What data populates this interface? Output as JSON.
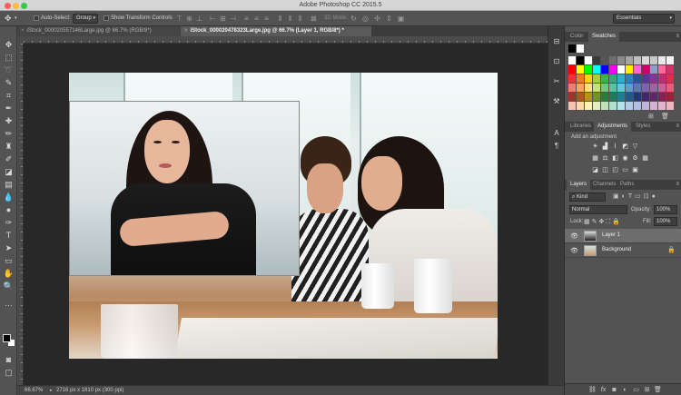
{
  "app": {
    "title": "Adobe Photoshop CC 2015.5"
  },
  "options_bar": {
    "auto_select_label": "Auto-Select:",
    "auto_select_value": "Group",
    "transform_controls_label": "Show Transform Controls",
    "mode_3d_label": "3D Mode:",
    "workspace": "Essentials"
  },
  "tabs": [
    {
      "label": "iStock_000020557146Large.jpg @ 66.7% (RGB/8*)",
      "active": false
    },
    {
      "label": "iStock_000020478323Large.jpg @ 66.7% (Layer 1, RGB/8*) *",
      "active": true
    }
  ],
  "status": {
    "zoom": "66.67%",
    "doc_info": "2716 px x 1810 px (300 ppi)"
  },
  "color_panel": {
    "tabs": [
      "Color",
      "Swatches"
    ],
    "active_tab": "Swatches",
    "swatch_rows": [
      [
        "#ffffff",
        "#000000",
        "#ffffff",
        "#3a3a3a",
        "#555555",
        "#6f6f6f",
        "#8a8a8a",
        "#a4a4a4",
        "#bfbfbf",
        "#d9d9d9",
        "#c8c8c8",
        "#e8e8e8",
        "#f4f4f4"
      ],
      [
        "#ff0000",
        "#ffff00",
        "#00ff00",
        "#00ffff",
        "#0000ff",
        "#ff00ff",
        "#ffffff",
        "#ffee00",
        "#ff66cc",
        "#cc0066",
        "#9999cc",
        "#ff6699",
        "#cc3366"
      ],
      [
        "#ee3333",
        "#f07b22",
        "#f5d415",
        "#9cd43a",
        "#3db24a",
        "#2fa985",
        "#27b3c9",
        "#2a7fc1",
        "#2e4ea0",
        "#5a3593",
        "#8b3292",
        "#b92e79",
        "#d3314f"
      ],
      [
        "#f47b6b",
        "#f9a65a",
        "#fde27a",
        "#c5e07d",
        "#7cc576",
        "#5ec0a2",
        "#63c7d8",
        "#5b9ed4",
        "#5d75b9",
        "#7f62ad",
        "#a55fa8",
        "#c8609b",
        "#e0627a"
      ],
      [
        "#a8302a",
        "#a85a1f",
        "#b39716",
        "#6f942e",
        "#2d7d37",
        "#1f7a5e",
        "#1e7f91",
        "#205b8a",
        "#223870",
        "#412768",
        "#632469",
        "#852256",
        "#962338"
      ],
      [
        "#f9c0b4",
        "#fcd6ad",
        "#fdf0b9",
        "#e1efbc",
        "#bfe2b9",
        "#b0dfcf",
        "#b3e3ec",
        "#aecde9",
        "#b1bedf",
        "#c2b4d7",
        "#d4b2d4",
        "#e6b3cd",
        "#f0b5c0"
      ]
    ]
  },
  "adjustments_panel": {
    "tabs": [
      "Libraries",
      "Adjustments",
      "Styles"
    ],
    "active_tab": "Adjustments",
    "heading": "Add an adjustment"
  },
  "layers_panel": {
    "tabs": [
      "Layers",
      "Channels",
      "Paths"
    ],
    "active_tab": "Layers",
    "filter": "Kind",
    "blend_mode": "Normal",
    "opacity_label": "Opacity:",
    "opacity": "100%",
    "lock_label": "Lock:",
    "fill_label": "Fill:",
    "fill": "100%",
    "layers": [
      {
        "name": "Layer 1",
        "selected": true
      },
      {
        "name": "Background",
        "selected": false
      }
    ],
    "footer_fx": "fx"
  }
}
